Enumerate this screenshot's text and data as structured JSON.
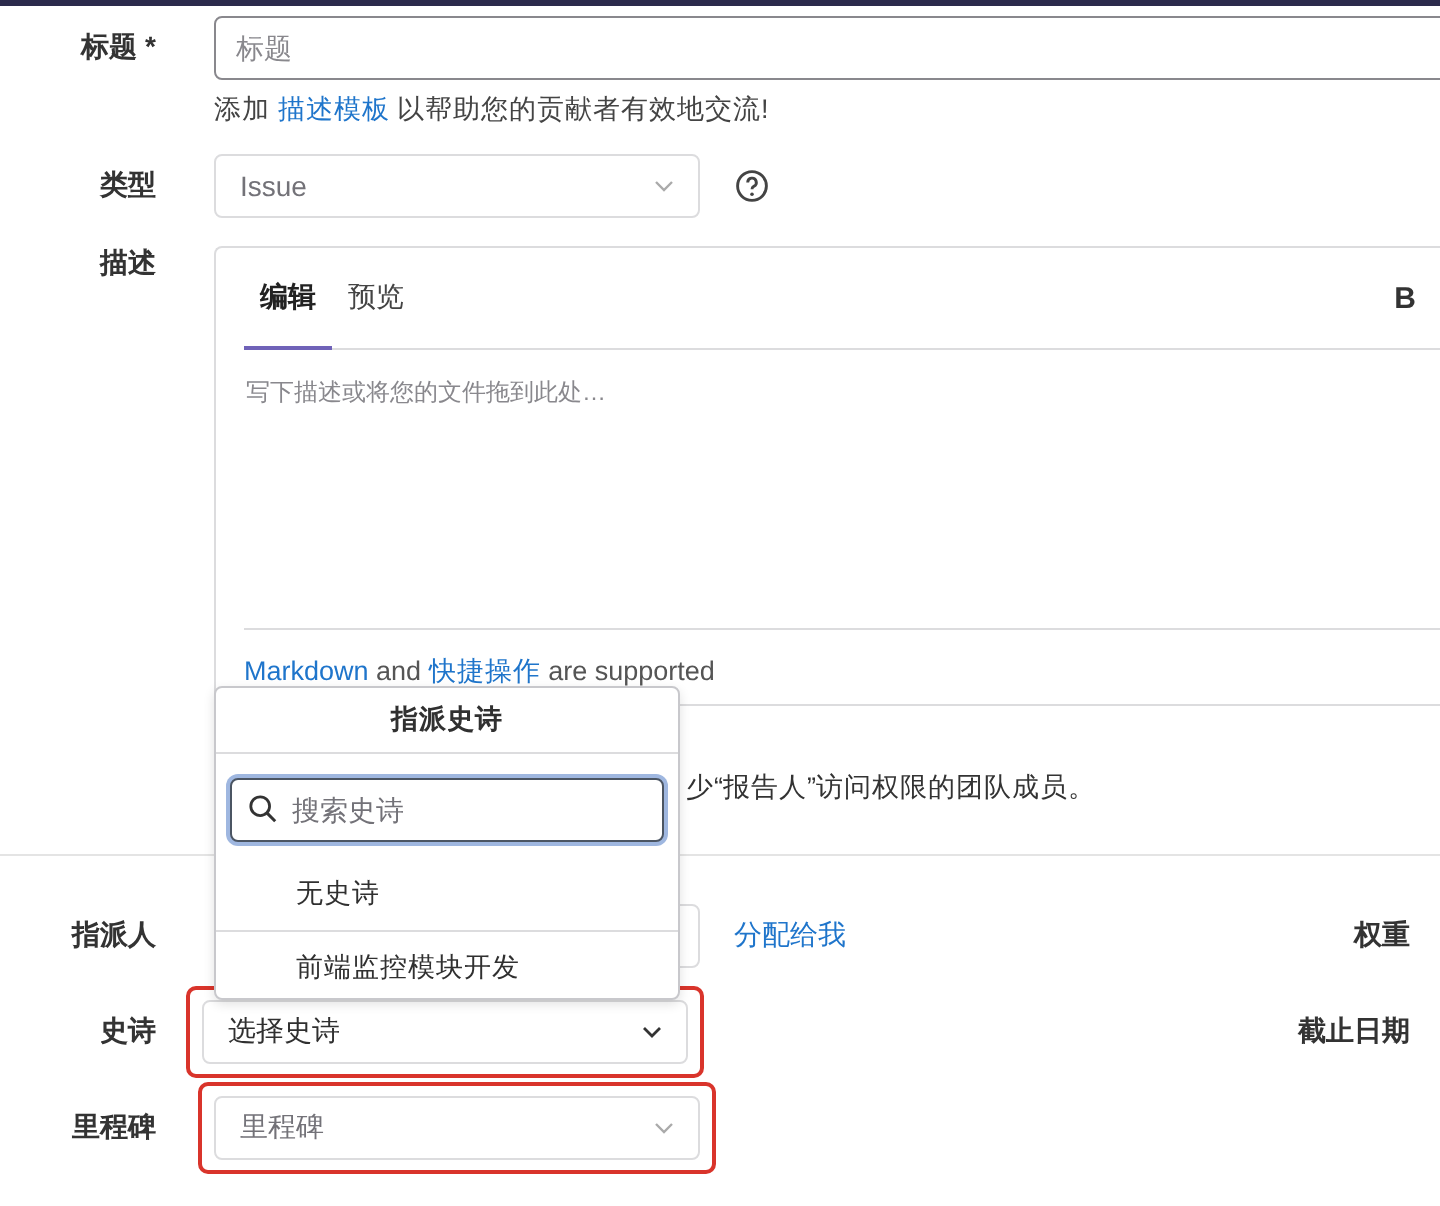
{
  "title_field": {
    "label": "标题 *",
    "placeholder": "标题"
  },
  "template_hint": {
    "before": "添加",
    "link": "描述模板",
    "after": "以帮助您的贡献者有效地交流!"
  },
  "type_field": {
    "label": "类型",
    "value": "Issue"
  },
  "description": {
    "label": "描述",
    "tabs": [
      {
        "label": "编辑",
        "selected": true
      },
      {
        "label": "预览",
        "selected": false
      }
    ],
    "toolbar": [
      "B"
    ],
    "placeholder": "写下描述或将您的文件拖到此处…",
    "footer": {
      "link1": "Markdown",
      "mid": "and",
      "link2": "快捷操作",
      "after": "are supported"
    }
  },
  "confidential_note": "少“报告人”访问权限的团队成员。",
  "assignee": {
    "label": "指派人",
    "assign_me": "分配给我",
    "side_label": "权重"
  },
  "epic": {
    "label": "史诗",
    "value": "选择史诗",
    "highlighted": true,
    "side_label": "截止日期"
  },
  "milestone": {
    "label": "里程碑",
    "placeholder": "里程碑",
    "highlighted": true
  },
  "epic_dropdown": {
    "title": "指派史诗",
    "search_placeholder": "搜索史诗",
    "items": [
      {
        "label": "无史诗"
      },
      {
        "label": "前端监控模块开发"
      }
    ]
  }
}
